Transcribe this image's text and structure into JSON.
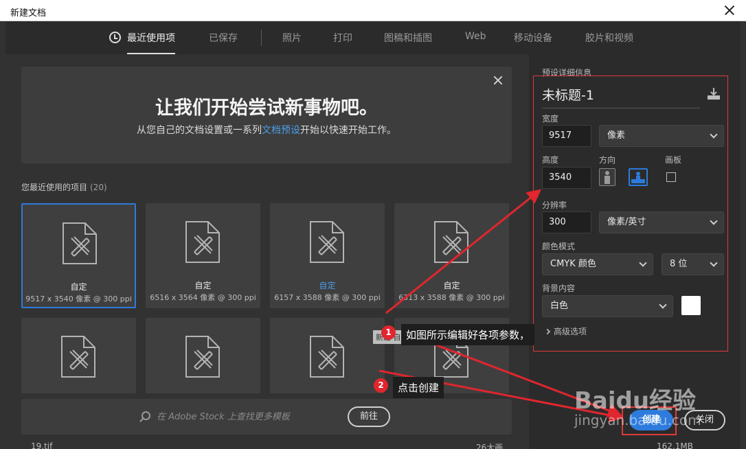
{
  "window": {
    "title": "新建文档"
  },
  "tabs": [
    {
      "label": "最近使用项"
    },
    {
      "label": "已保存"
    },
    {
      "label": "照片"
    },
    {
      "label": "打印"
    },
    {
      "label": "图稿和插图"
    },
    {
      "label": "Web"
    },
    {
      "label": "移动设备"
    },
    {
      "label": "胶片和视频"
    }
  ],
  "welcome": {
    "heading": "让我们开始尝试新事物吧。",
    "sub_before": "从您自己的文档设置或一系列",
    "sub_link": "文档预设",
    "sub_after": "开始以快速开始工作。"
  },
  "recent": {
    "label": "您最近使用的项目",
    "count": "(20)"
  },
  "cards": [
    {
      "name": "自定",
      "dims": "9517 x 3540 像素 @ 300 ppi"
    },
    {
      "name": "自定",
      "dims": "6516 x 3564 像素 @ 300 ppi"
    },
    {
      "name": "自定",
      "dims": "6157 x 3588 像素 @ 300 ppi"
    },
    {
      "name": "自定",
      "dims": "6313 x 3588 像素 @ 300 ppi"
    }
  ],
  "tooltip": "新建 自定 文档 - 6157 x 3588 像素",
  "search": {
    "placeholder": "在 Adobe Stock 上查找更多模板",
    "button": "前往"
  },
  "bottom_row": {
    "file": "19.tif",
    "size1": "26大画",
    "size2": "162.1MB"
  },
  "preset": {
    "section_label": "预设详细信息",
    "doc_name": "未标题-1",
    "width_label": "宽度",
    "width_value": "9517",
    "width_unit": "像素",
    "height_label": "高度",
    "height_value": "3540",
    "orientation_label": "方向",
    "artboard_label": "画板",
    "resolution_label": "分辨率",
    "resolution_value": "300",
    "resolution_unit": "像素/英寸",
    "color_mode_label": "颜色模式",
    "color_mode_value": "CMYK 颜色",
    "bit_depth": "8 位",
    "background_label": "背景内容",
    "background_value": "白色",
    "advanced_label": "高级选项"
  },
  "actions": {
    "create": "创建",
    "close": "关闭"
  },
  "annotations": [
    {
      "number": "1",
      "text": "如图所示编辑好各项参数，"
    },
    {
      "number": "2",
      "text": "点击创建"
    }
  ],
  "watermark": {
    "brand": "Baidu经验",
    "url": "jingyan.baidu.com"
  },
  "colors": {
    "accent": "#2d7bdc",
    "annotation_red": "#e0262e",
    "link_blue": "#4d9de8"
  }
}
